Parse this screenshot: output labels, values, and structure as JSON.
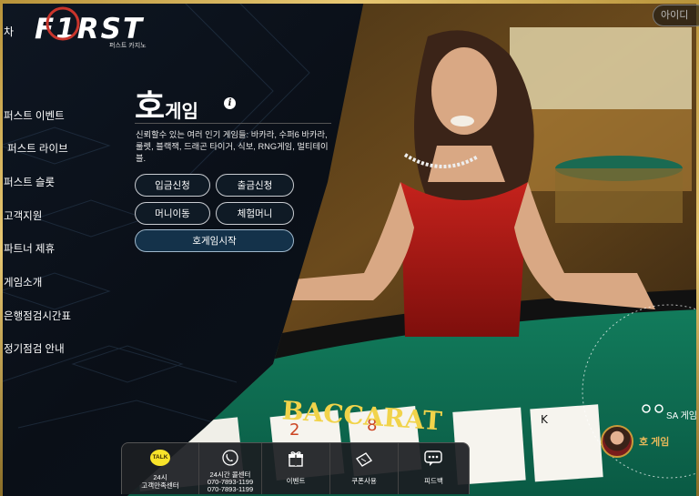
{
  "brand": {
    "logo_text": "F1RST",
    "logo_sub": "퍼스트 카지노",
    "accent": "#c9352c",
    "gold": "#d4aa52"
  },
  "header": {
    "login_label": "아이디",
    "corner_char": "차"
  },
  "sidebar": {
    "items": [
      {
        "label": "퍼스트 이벤트"
      },
      {
        "label": "퍼스트 라이브"
      },
      {
        "label": "퍼스트 슬롯"
      },
      {
        "label": "고객지원"
      },
      {
        "label": "파트너 제휴"
      },
      {
        "label": "게임소개"
      },
      {
        "label": "은행점검시간표"
      },
      {
        "label": "정기점검 안내"
      }
    ]
  },
  "panel": {
    "title_big": "호",
    "title_small": "게임",
    "info_icon": "info-icon",
    "description": "신뢰할수 있는 여러 인기 게임들: 바카라, 수퍼6 바카라, 룰렛, 블랙잭, 드래곤 타이거, 식보, RNG게임, 멀티테이블.",
    "buttons": {
      "deposit": "입금신청",
      "withdraw": "출금신청",
      "money_move": "머니이동",
      "trial_money": "체험머니",
      "start_game": "호게임시작"
    }
  },
  "table_sign": "BACCARAT",
  "right_panel": {
    "sa_label": "SA 게임",
    "ho_label": "호 게임"
  },
  "dock": {
    "items": [
      {
        "icon": "kakao-talk-icon",
        "badge": "TALK",
        "line1": "24시",
        "line2": "고객만족센터"
      },
      {
        "icon": "phone-icon",
        "line1": "24시간 콜센터",
        "line2": "070-7893-1199",
        "line3": "070-7893-1199"
      },
      {
        "icon": "gift-icon",
        "line1": "이벤트"
      },
      {
        "icon": "coupon-icon",
        "line1": "쿠폰사용"
      },
      {
        "icon": "chat-bubble-icon",
        "line1": "피드백"
      }
    ]
  }
}
